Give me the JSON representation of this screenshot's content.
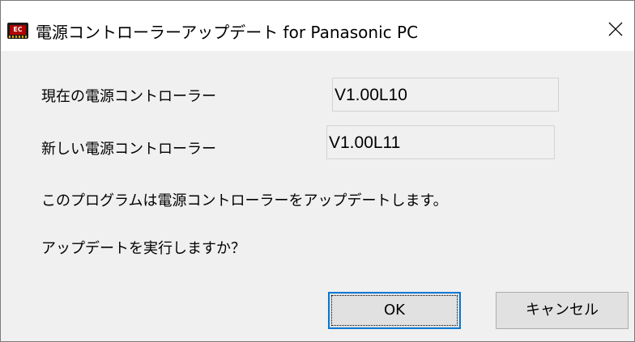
{
  "window": {
    "title": "電源コントローラーアップデート for Panasonic PC",
    "icon_text": "EC",
    "icon_name": "ec-chip-icon",
    "close_icon": "close-icon"
  },
  "current_version": {
    "label": "現在の電源コントローラー",
    "value": "V1.00L10"
  },
  "new_version": {
    "label": "新しい電源コントローラー",
    "value": "V1.00L11"
  },
  "message": {
    "description": "このプログラムは電源コントローラーをアップデートします。",
    "question": "アップデートを実行しますか？"
  },
  "buttons": {
    "ok": "OK",
    "cancel": "キャンセル"
  },
  "colors": {
    "accent": "#0078d7",
    "chip_red": "#b00000"
  }
}
